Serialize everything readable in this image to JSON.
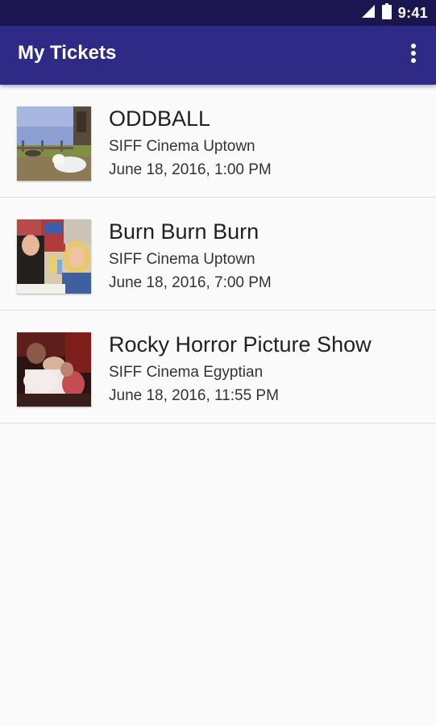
{
  "status_bar": {
    "time": "9:41",
    "icons": [
      "signal-icon",
      "battery-icon"
    ]
  },
  "app_bar": {
    "title": "My Tickets",
    "menu_icon": "overflow-menu-icon"
  },
  "tickets": [
    {
      "title": "ODDBALL",
      "venue": "SIFF Cinema Uptown",
      "datetime": "June 18, 2016, 1:00 PM"
    },
    {
      "title": "Burn Burn Burn",
      "venue": "SIFF Cinema Uptown",
      "datetime": "June 18, 2016, 7:00 PM"
    },
    {
      "title": "Rocky Horror Picture Show",
      "venue": "SIFF Cinema Egyptian",
      "datetime": "June 18, 2016, 11:55 PM"
    }
  ],
  "colors": {
    "status_bar": "#1b1650",
    "app_bar": "#2e2a85",
    "background": "#fafafa"
  }
}
